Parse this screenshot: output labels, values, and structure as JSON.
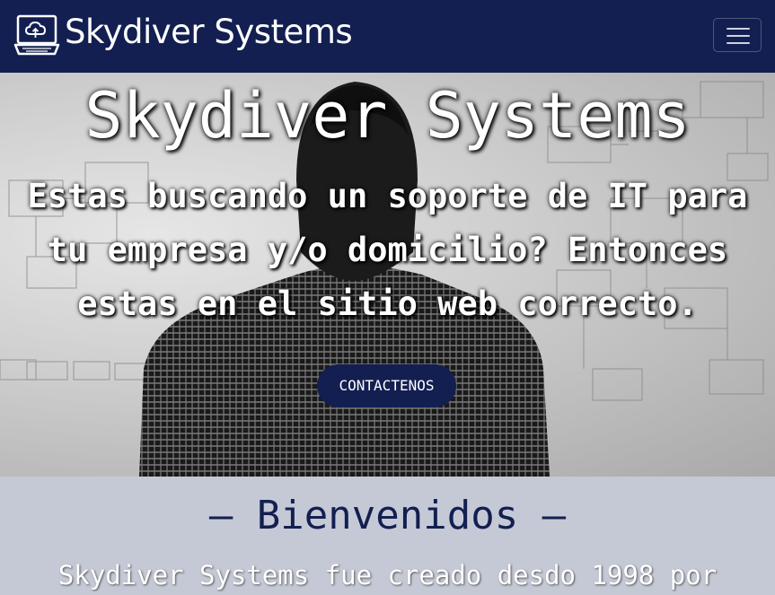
{
  "navbar": {
    "brand": "Skydiver Systems",
    "logo_icon": "cloud-laptop-icon",
    "menu_icon": "hamburger-icon"
  },
  "hero": {
    "title": "Skydiver Systems",
    "subtitle_lines": [
      "Estas buscando un soporte de IT para",
      "tu empresa y/o domicilio? Entonces",
      "estas en el sitio web correcto."
    ],
    "cta_label": "CONTACTENOS"
  },
  "welcome": {
    "title": "– Bienvenidos –",
    "text": "Skydiver Systems fue creado desdo 1998 por"
  },
  "colors": {
    "navy": "#131f51",
    "welcome_bg": "#c5c9d6"
  }
}
